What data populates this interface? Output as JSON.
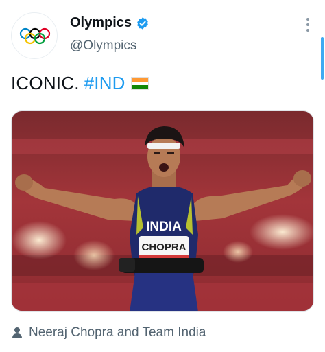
{
  "account": {
    "display_name": "Olympics",
    "handle": "@Olympics",
    "verified": true,
    "avatar_icon": "olympic-rings-icon"
  },
  "tweet": {
    "text": "ICONIC.",
    "hashtag": "#IND",
    "emoji": "india-flag-icon"
  },
  "media": {
    "bib_country": "INDIA",
    "bib_name": "CHOPRA"
  },
  "tagged": {
    "icon": "person-icon",
    "label": "Neeraj Chopra and Team India"
  },
  "colors": {
    "accent": "#1d9bf0",
    "text_primary": "#0f1419",
    "text_secondary": "#536471",
    "flag_saffron": "#ff9933",
    "flag_green": "#138808"
  }
}
